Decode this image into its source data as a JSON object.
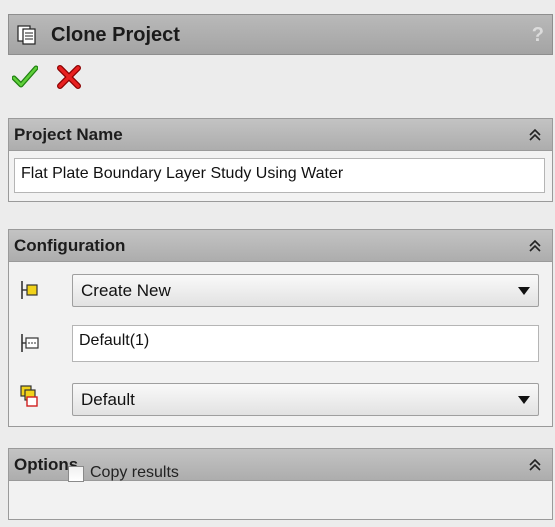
{
  "window": {
    "title": "Clone Project",
    "help_label": "?"
  },
  "actions": {
    "ok_icon": "green-checkmark-icon",
    "cancel_icon": "red-x-icon"
  },
  "project_name_group": {
    "title": "Project Name",
    "value": "Flat Plate Boundary Layer Study Using Water"
  },
  "configuration_group": {
    "title": "Configuration",
    "mode_select": {
      "selected": "Create New"
    },
    "config_name": {
      "value": "Default(1)"
    },
    "base_select": {
      "selected": "Default"
    }
  },
  "options_group": {
    "title": "Options",
    "copy_results": {
      "label": "Copy results",
      "checked": false
    }
  },
  "colors": {
    "header_bg": "#b0b0b0",
    "panel_bg": "#ececec",
    "ok_green": "#2f9e1a",
    "cancel_red": "#d01010"
  }
}
